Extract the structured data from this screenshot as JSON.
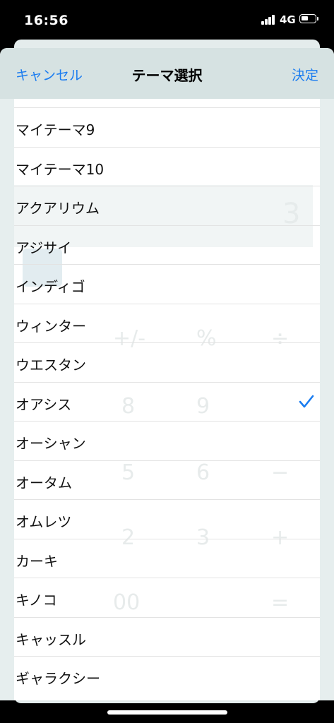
{
  "status_bar": {
    "time": "16:56",
    "network": "4G"
  },
  "nav": {
    "cancel_label": "キャンセル",
    "title": "テーマ選択",
    "done_label": "決定"
  },
  "themes": [
    {
      "label": "マイテーマ9",
      "selected": false
    },
    {
      "label": "マイテーマ10",
      "selected": false
    },
    {
      "label": "アクアリウム",
      "selected": false
    },
    {
      "label": "アジサイ",
      "selected": false
    },
    {
      "label": "インディゴ",
      "selected": false
    },
    {
      "label": "ウィンター",
      "selected": false
    },
    {
      "label": "ウエスタン",
      "selected": false
    },
    {
      "label": "オアシス",
      "selected": true
    },
    {
      "label": "オーシャン",
      "selected": false
    },
    {
      "label": "オータム",
      "selected": false
    },
    {
      "label": "オムレツ",
      "selected": false
    },
    {
      "label": "カーキ",
      "selected": false
    },
    {
      "label": "キノコ",
      "selected": false
    },
    {
      "label": "キャッスル",
      "selected": false
    },
    {
      "label": "ギャラクシー",
      "selected": false
    }
  ],
  "colors": {
    "accent": "#1a7cf0",
    "navbar_bg": "#d6e2e2"
  }
}
